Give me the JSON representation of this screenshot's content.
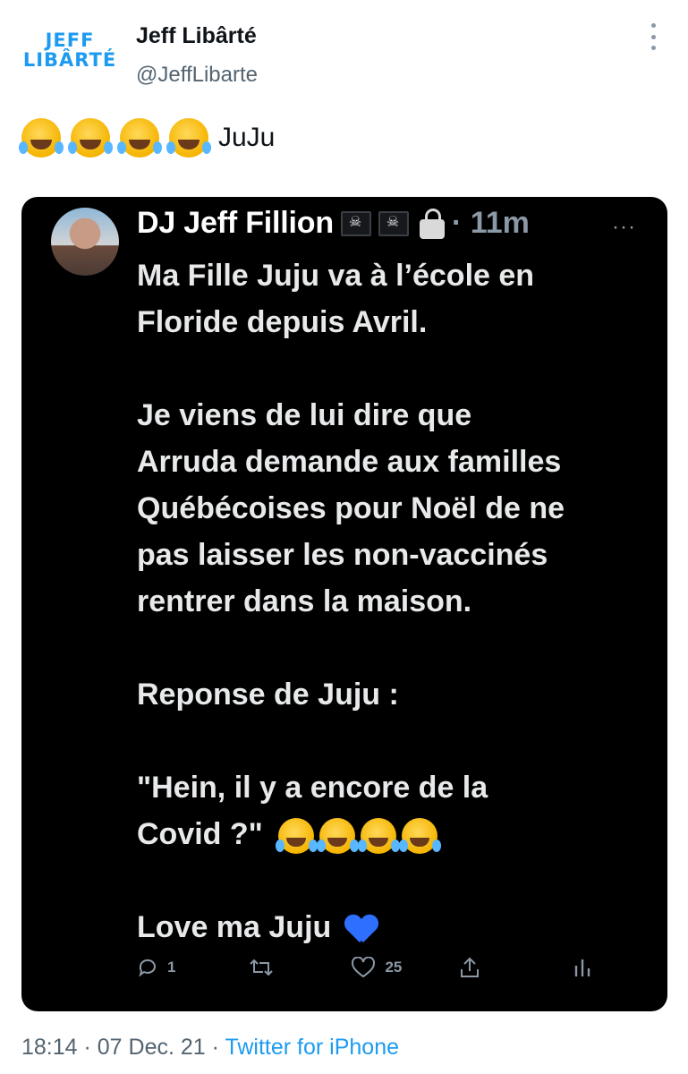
{
  "header": {
    "logo_line1": "JEFF",
    "logo_line2": "LIBÂRTÉ",
    "author_name": "Jeff Libârté",
    "author_handle": "@JeffLibarte"
  },
  "tweet": {
    "text": "JuJu",
    "emoji_count": 4
  },
  "quoted": {
    "name": "DJ Jeff Fillion",
    "time": "· 11m",
    "lines": [
      "Ma Fille Juju va à l’école en",
      "Floride depuis Avril.",
      "",
      "Je viens de lui dire que",
      "Arruda demande aux familles",
      "Québécoises pour Noël de ne",
      "pas laisser les non-vaccinés",
      "rentrer dans la maison.",
      "",
      "Reponse de Juju :",
      "",
      "\"Hein, il y a encore de la",
      "Covid ?\"",
      "",
      "Love ma Juju"
    ],
    "reply_count": "1",
    "like_count": "25"
  },
  "footer": {
    "meta": "18:14 · 07 Dec. 21 · ",
    "source": "Twitter for iPhone"
  },
  "colors": {
    "accent": "#1d9bf0",
    "card_bg": "#000000",
    "secondary_text": "#536471"
  }
}
